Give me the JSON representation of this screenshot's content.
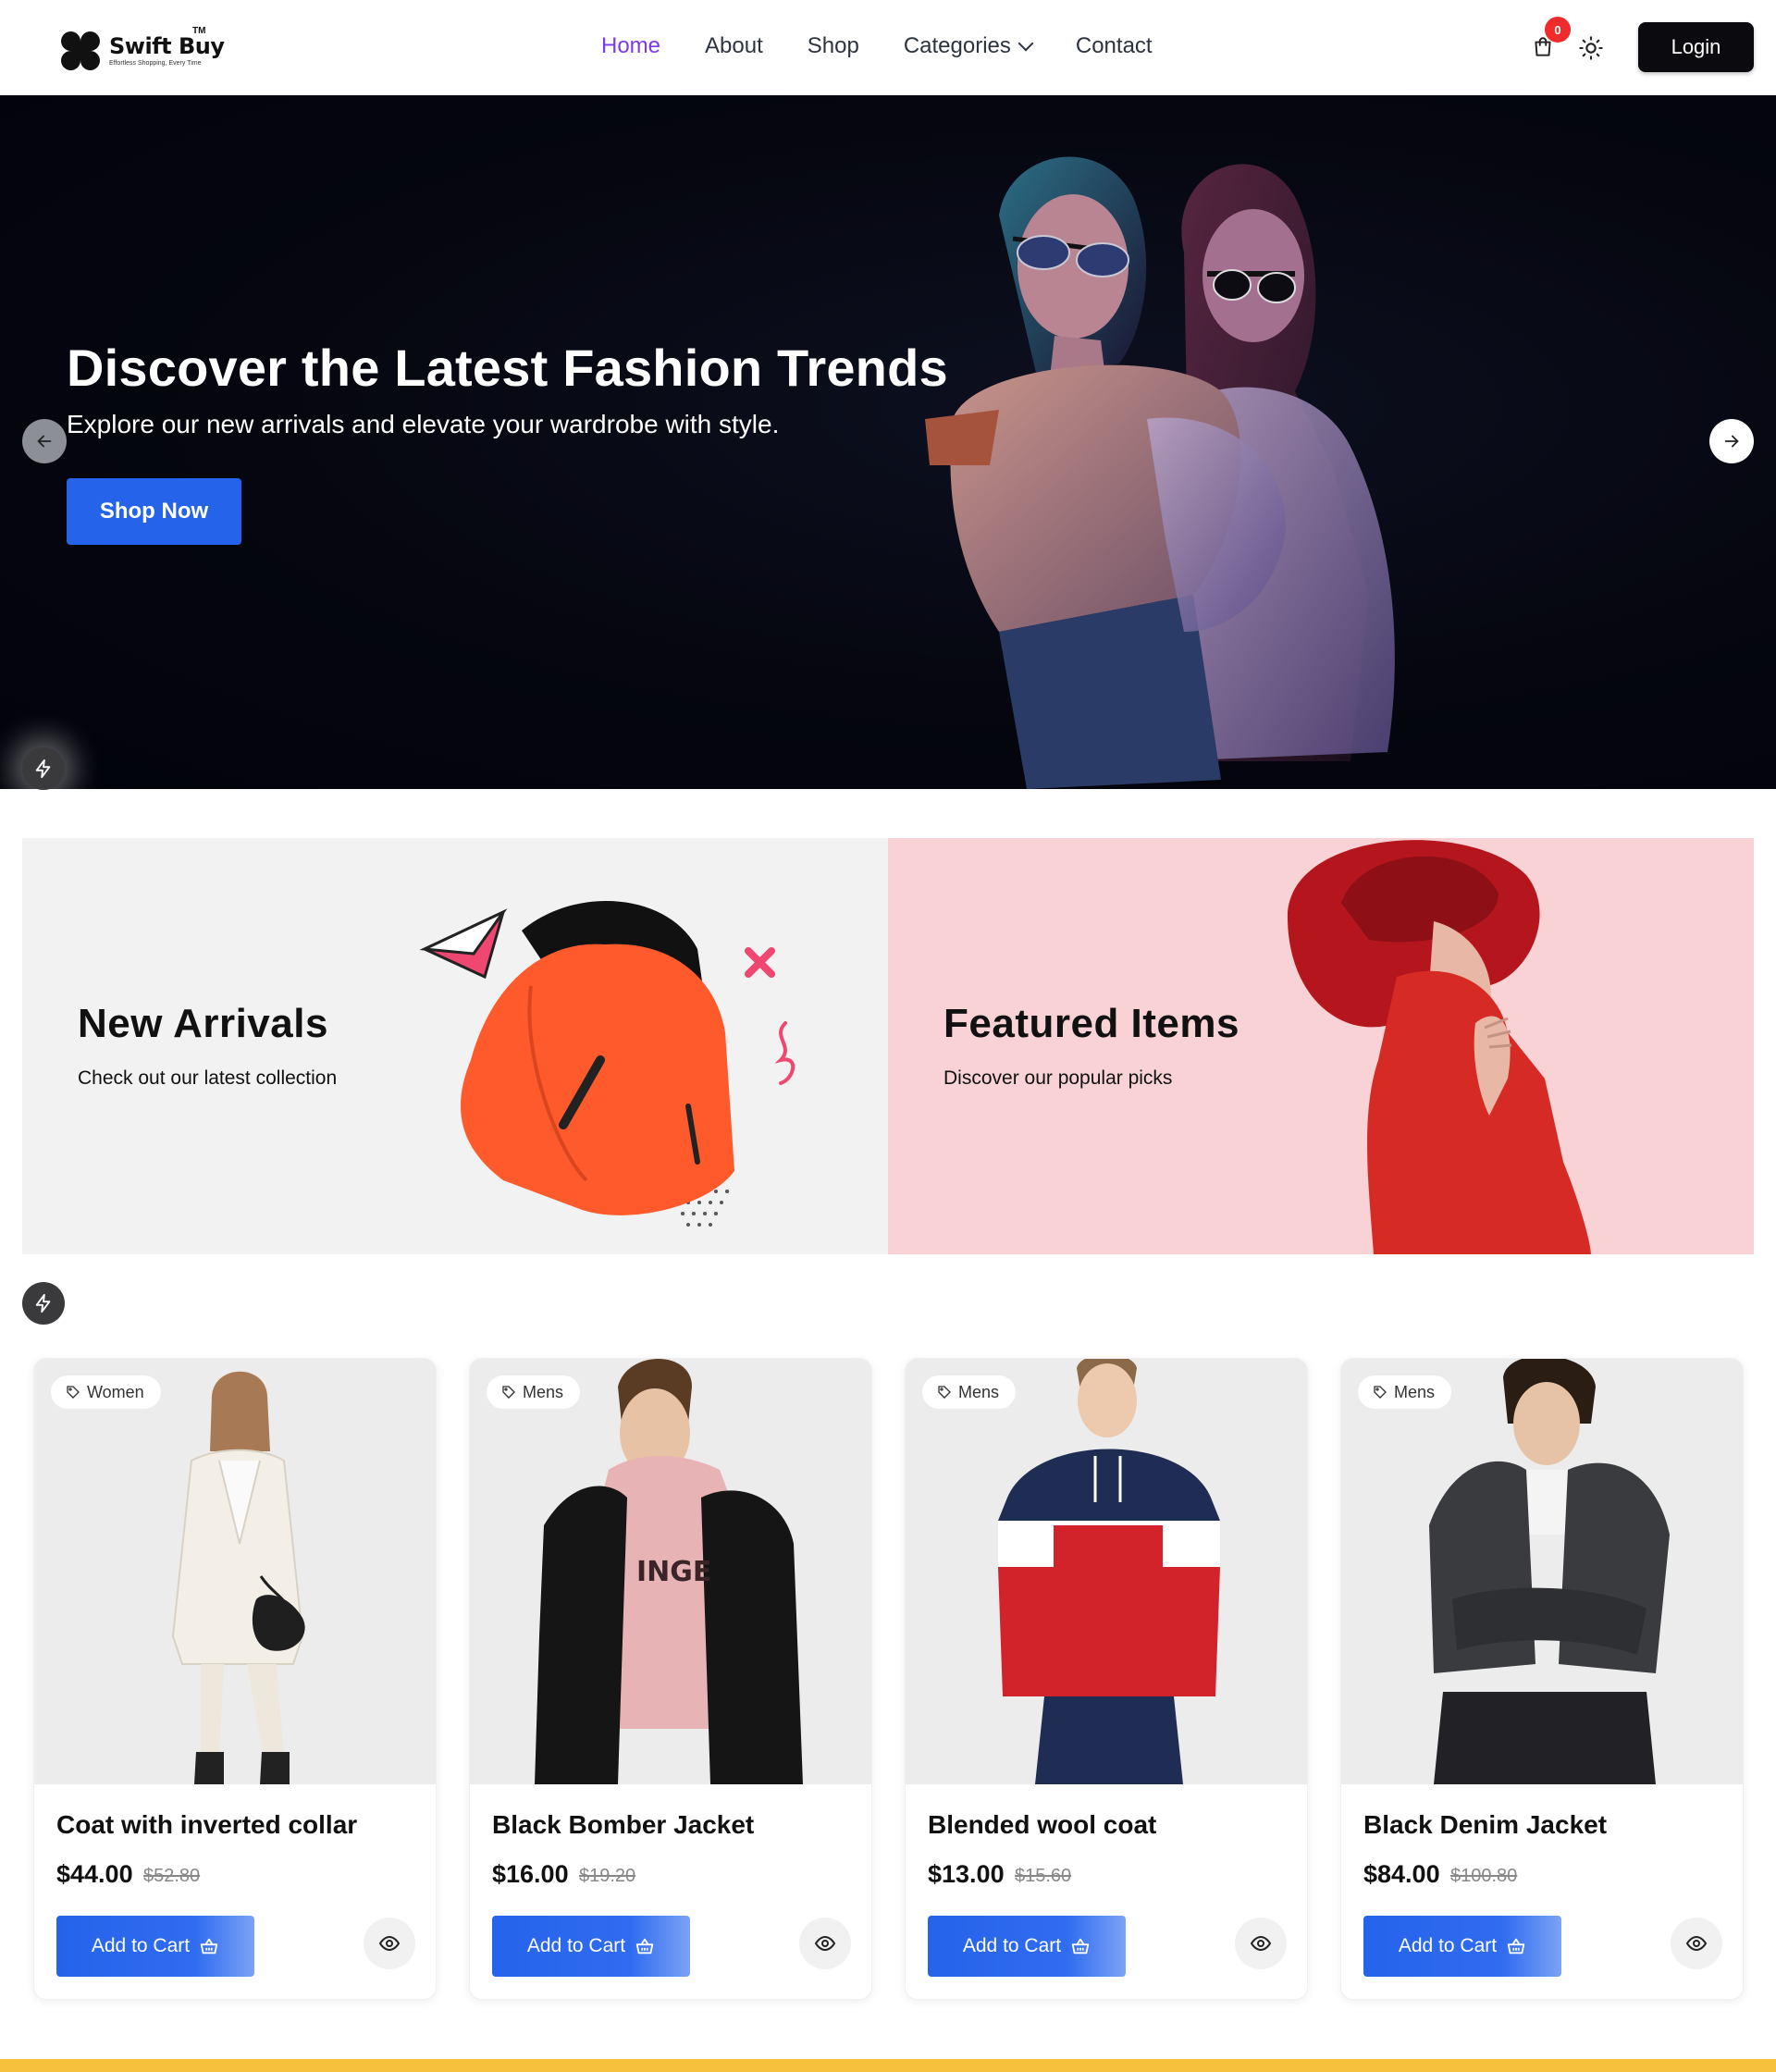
{
  "header": {
    "logo": {
      "name": "Swift Buy",
      "tm": "TM",
      "tagline": "Effortless Shopping, Every Time"
    },
    "nav": [
      {
        "label": "Home",
        "active": true
      },
      {
        "label": "About"
      },
      {
        "label": "Shop"
      },
      {
        "label": "Categories",
        "has_dropdown": true
      },
      {
        "label": "Contact"
      }
    ],
    "cart_count": "0",
    "login_label": "Login",
    "icons": {
      "cart": "shopping-bag-icon",
      "theme": "sun-icon"
    }
  },
  "hero": {
    "title": "Discover the Latest Fashion Trends",
    "subtitle": "Explore our new arrivals and elevate your wardrobe with style.",
    "cta_label": "Shop Now",
    "image_alt": "two women in sunglasses"
  },
  "promos": [
    {
      "title": "New Arrivals",
      "subtitle": "Check out our latest collection"
    },
    {
      "title": "Featured Items",
      "subtitle": "Discover our popular picks"
    }
  ],
  "products": [
    {
      "category": "Women",
      "name": "Coat with inverted collar",
      "price": "$44.00",
      "old_price": "$52.80",
      "cta": "Add to Cart"
    },
    {
      "category": "Mens",
      "name": "Black Bomber Jacket",
      "price": "$16.00",
      "old_price": "$19.20",
      "cta": "Add to Cart"
    },
    {
      "category": "Mens",
      "name": "Blended wool coat",
      "price": "$13.00",
      "old_price": "$15.60",
      "cta": "Add to Cart"
    },
    {
      "category": "Mens",
      "name": "Black Denim Jacket",
      "price": "$84.00",
      "old_price": "$100.80",
      "cta": "Add to Cart"
    }
  ],
  "colors": {
    "accent": "#2563eb",
    "nav_active": "#7c3aed",
    "badge": "#ef2b2b",
    "promo_left_bg": "#f2f2f3",
    "promo_right_bg": "#f8d2d4",
    "bottom_strip": "#f6c23e"
  }
}
